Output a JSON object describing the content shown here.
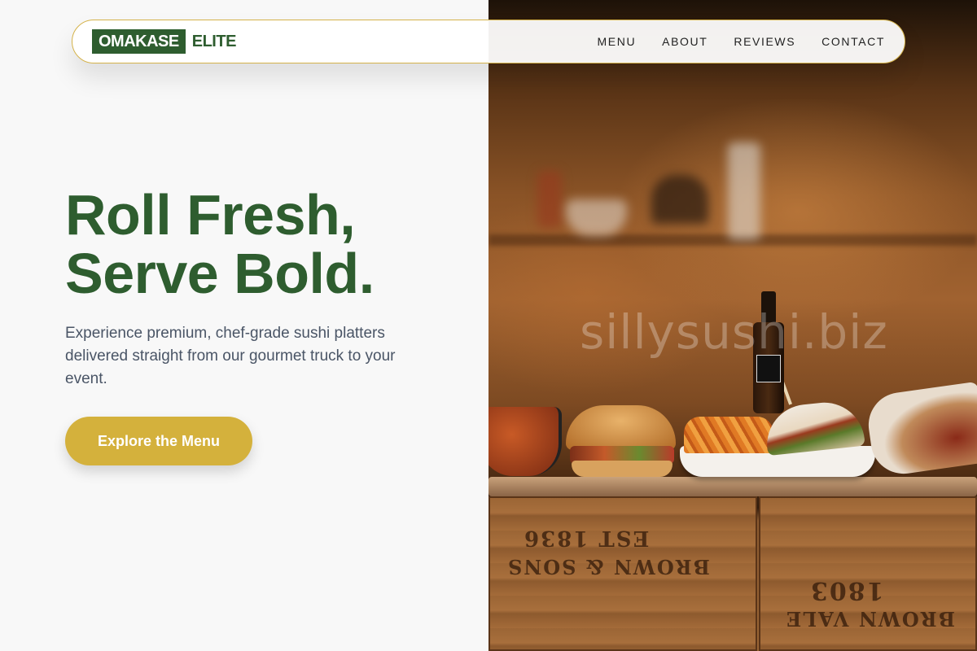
{
  "brand": {
    "logo_box": "OMAKASE",
    "logo_text": "ELITE",
    "primary_color": "#2e5d2f",
    "accent_color": "#d4b13c"
  },
  "nav": {
    "links": [
      "MENU",
      "ABOUT",
      "REVIEWS",
      "CONTACT"
    ]
  },
  "hero": {
    "title_line1": "Roll Fresh,",
    "title_line2": "Serve Bold.",
    "subtitle": "Experience premium, chef-grade sushi platters delivered straight from our gourmet truck to your event.",
    "cta_label": "Explore the Menu"
  },
  "image": {
    "watermark": "sillysushi.biz",
    "crate_text_1": "EST 1836",
    "crate_text_2": "BROWN & SONS",
    "crate_text_3": "1803",
    "crate_text_4": "BROWN VALE"
  }
}
